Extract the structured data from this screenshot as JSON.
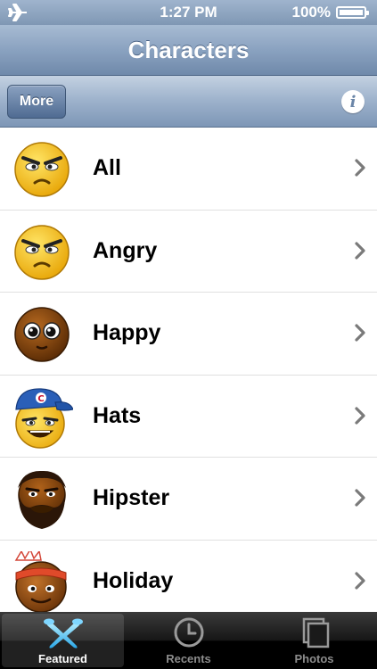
{
  "status_bar": {
    "time": "1:27 PM",
    "battery": "100%",
    "icons": [
      "airplane-icon",
      "battery-icon"
    ]
  },
  "nav": {
    "title": "Characters"
  },
  "toolbar": {
    "more_label": "More",
    "info_label": "i"
  },
  "list": {
    "items": [
      {
        "label": "All",
        "icon": "angry-yellow-face"
      },
      {
        "label": "Angry",
        "icon": "angry-yellow-face"
      },
      {
        "label": "Happy",
        "icon": "brown-wide-eyed-face"
      },
      {
        "label": "Hats",
        "icon": "yellow-face-blue-cap"
      },
      {
        "label": "Hipster",
        "icon": "bearded-brown-face"
      },
      {
        "label": "Holiday",
        "icon": "brown-face-headband"
      }
    ]
  },
  "tabbar": {
    "tabs": [
      {
        "label": "Featured",
        "icon": "featured-icon",
        "selected": true
      },
      {
        "label": "Recents",
        "icon": "clock-icon",
        "selected": false
      },
      {
        "label": "Photos",
        "icon": "photos-icon",
        "selected": false
      }
    ]
  },
  "colors": {
    "nav_blue": "#8aa2c0",
    "button_blue": "#4f6b92",
    "emoji_yellow": "#f6c51d",
    "emoji_brown": "#8a4a12",
    "cap_blue": "#2a5fb8",
    "tab_bar_black": "#000000"
  }
}
